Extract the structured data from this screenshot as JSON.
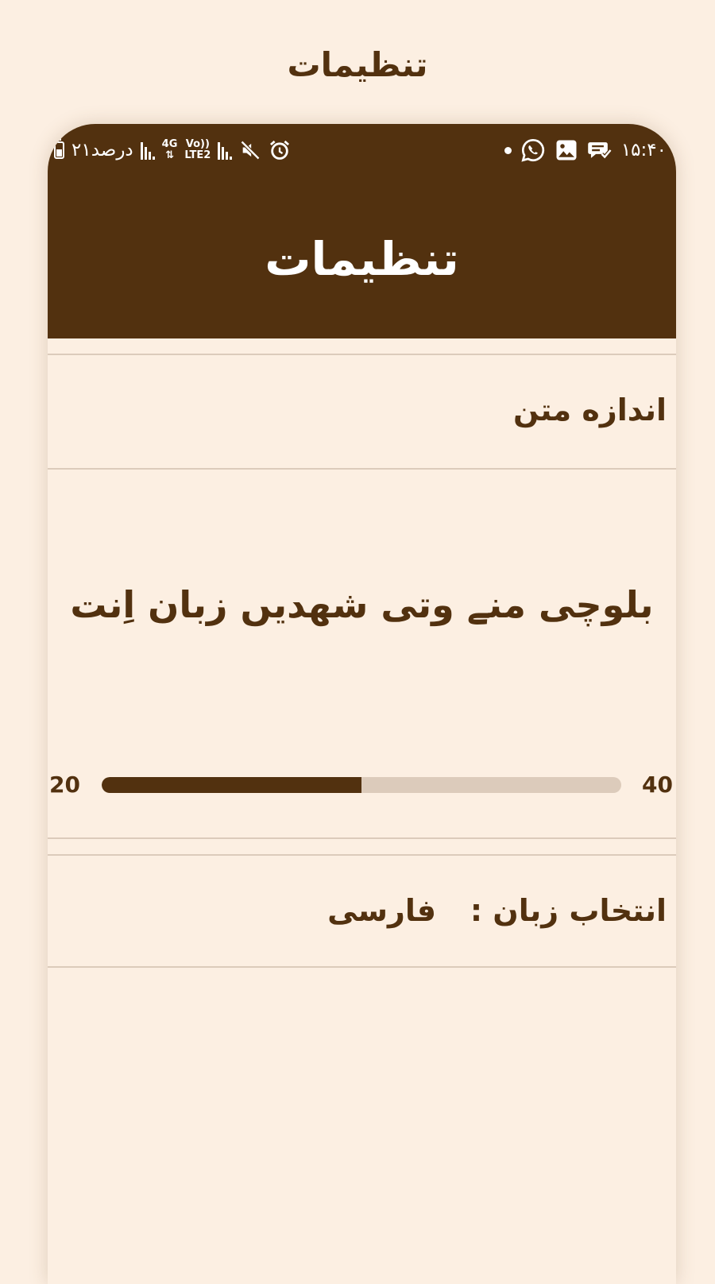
{
  "page": {
    "title": "تنظیمات"
  },
  "status_bar": {
    "time": "۱۵:۴۰",
    "battery": "۲۱درصد",
    "network_type": "4G",
    "volte": "Vo))",
    "lte": "LTE2",
    "icons_right": [
      "dot-icon",
      "whatsapp-icon",
      "gallery-icon",
      "chat-check-icon"
    ],
    "icons_left": [
      "battery-icon",
      "signal-icon",
      "network-icon",
      "signal-icon",
      "mute-icon",
      "alarm-icon"
    ]
  },
  "app_bar": {
    "title": "تنظیمات"
  },
  "text_size": {
    "label": "اندازه متن",
    "preview": "بلوچی منے وتی شهدیں زبان اِنت",
    "slider": {
      "min_label": "20",
      "max_label": "40",
      "min": 20,
      "max": 40,
      "value": 30,
      "fill_fraction": 0.5
    }
  },
  "language": {
    "label": "انتخاب زبان :",
    "value": "فارسی"
  },
  "colors": {
    "background": "#fcefe2",
    "primary": "#52310f",
    "divider": "#dccbbb",
    "on_primary": "#ffffff"
  }
}
